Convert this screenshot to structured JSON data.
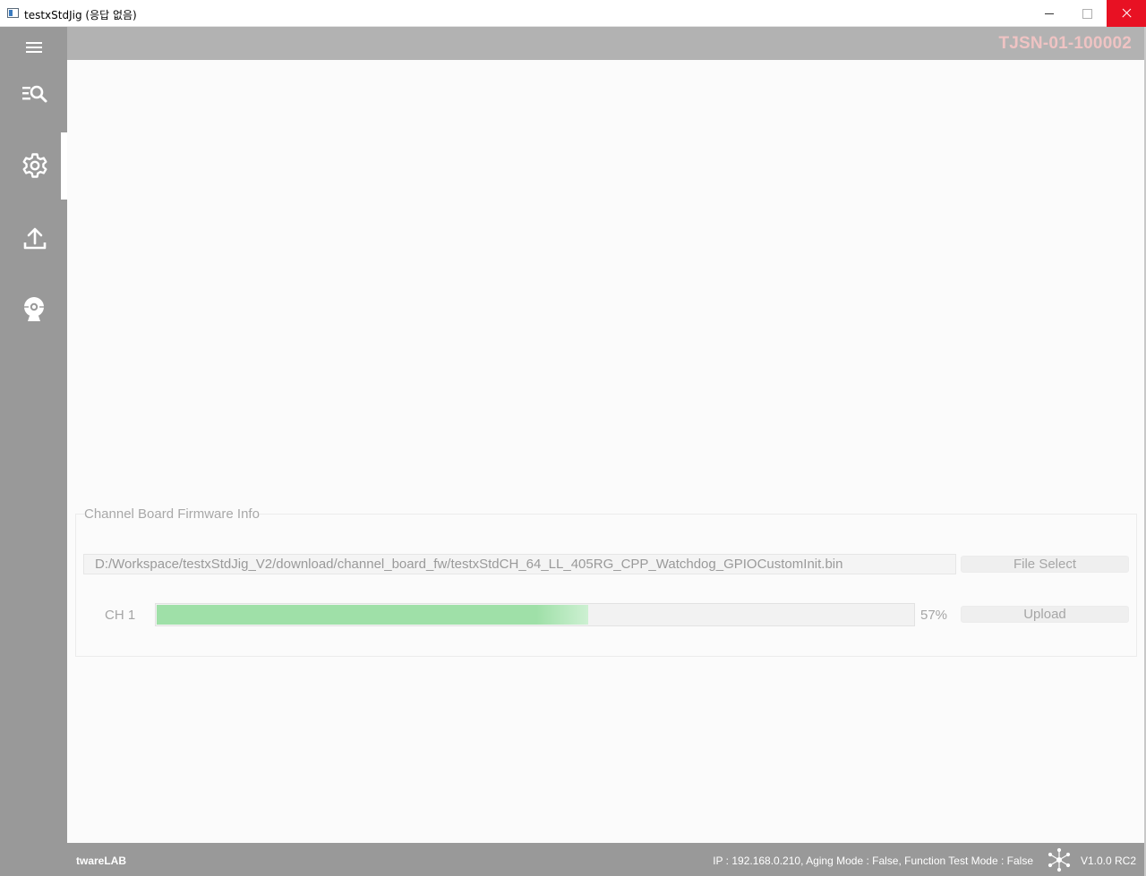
{
  "window": {
    "title": "testxStdJig (응답 없음)"
  },
  "sidebar": {
    "items": [
      {
        "icon": "menu-icon"
      },
      {
        "icon": "search-list-icon"
      },
      {
        "icon": "gear-icon",
        "active": true
      },
      {
        "icon": "upload-icon"
      },
      {
        "icon": "webcam-icon"
      }
    ]
  },
  "header": {
    "serial": "TJSN-01-100002",
    "serial_color": "#efc3c3"
  },
  "firmware": {
    "group_title": "Channel Board Firmware Info",
    "file_path": "D:/Workspace/testxStdJig_V2/download/channel_board_fw/testxStdCH_64_LL_405RG_CPP_Watchdog_GPIOCustomInit.bin",
    "file_select_label": "File Select",
    "channel_label": "CH 1",
    "progress_percent": 57,
    "progress_text": "57%",
    "upload_label": "Upload",
    "progress_color": "#9fe0a8"
  },
  "statusbar": {
    "brand": "twareLAB",
    "status": "IP : 192.168.0.210, Aging Mode : False, Function Test Mode : False",
    "version": "V1.0.0 RC2",
    "icon": "network-icon"
  }
}
